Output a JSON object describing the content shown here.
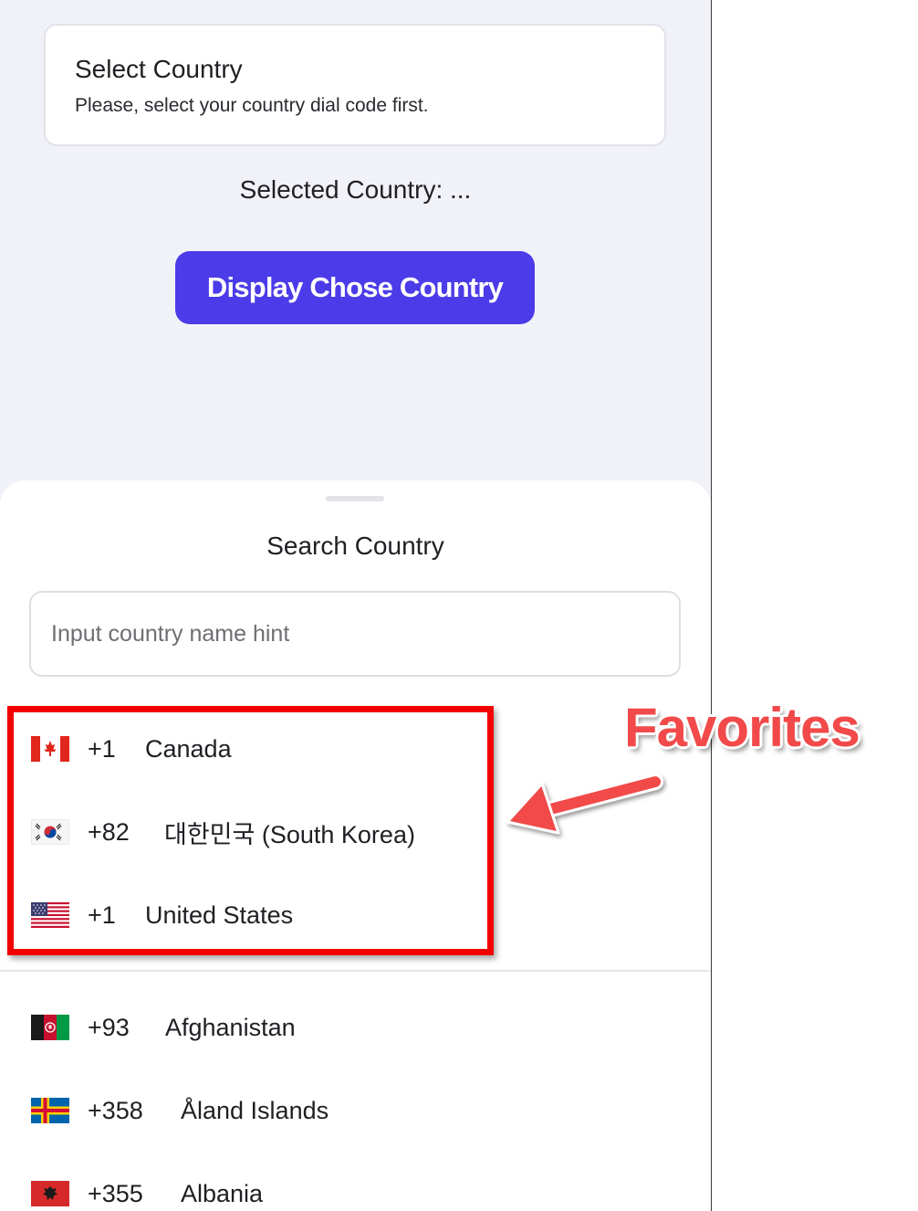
{
  "header_card": {
    "title": "Select Country",
    "subtitle": "Please, select your country dial code first."
  },
  "selected_country": "Selected Country: ...",
  "display_button": "Display Chose Country",
  "sheet": {
    "title": "Search Country",
    "search_placeholder": "Input country name hint"
  },
  "favorites": [
    {
      "flag": "canada-flag-icon",
      "code": "+1",
      "name": "Canada"
    },
    {
      "flag": "south-korea-flag-icon",
      "code": "+82",
      "name": "대한민국 (South Korea)"
    },
    {
      "flag": "united-states-flag-icon",
      "code": "+1",
      "name": "United States"
    }
  ],
  "countries": [
    {
      "flag": "afghanistan-flag-icon",
      "code": "+93",
      "name": "Afghanistan"
    },
    {
      "flag": "aland-islands-flag-icon",
      "code": "+358",
      "name": "Åland Islands"
    },
    {
      "flag": "albania-flag-icon",
      "code": "+355",
      "name": "Albania"
    }
  ],
  "annotation": {
    "label": "Favorites",
    "color": "#f20000"
  },
  "colors": {
    "accent": "#4b3be8",
    "background": "#f1f1f8"
  }
}
